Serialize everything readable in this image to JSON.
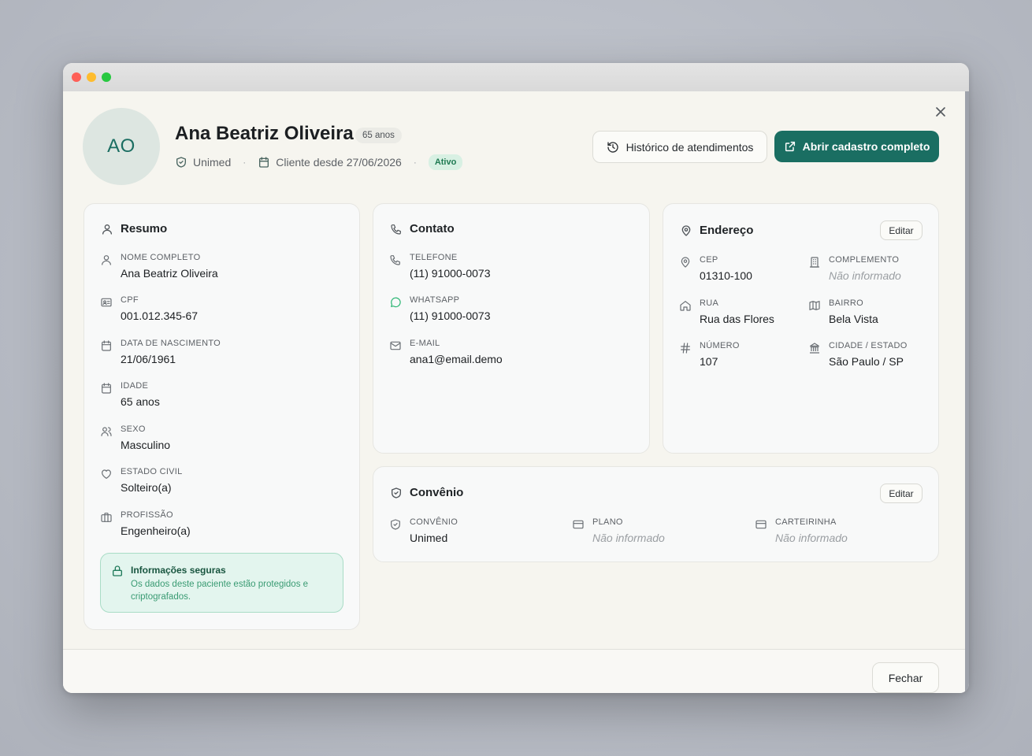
{
  "header": {
    "initials": "AO",
    "name": "Ana Beatriz Oliveira",
    "age_badge": "65 anos",
    "insurance": "Unimed",
    "client_since": "Cliente desde 27/06/2026",
    "status": "Ativo",
    "history_button": "Histórico de atendimentos",
    "open_button": "Abrir cadastro completo"
  },
  "resumo": {
    "title": "Resumo",
    "fields": [
      {
        "label": "NOME COMPLETO",
        "value": "Ana Beatriz Oliveira",
        "icon": "user-icon"
      },
      {
        "label": "CPF",
        "value": "001.012.345-67",
        "icon": "id-card-icon"
      },
      {
        "label": "DATA DE NASCIMENTO",
        "value": "21/06/1961",
        "icon": "calendar-icon"
      },
      {
        "label": "IDADE",
        "value": "65 anos",
        "icon": "calendar-icon"
      },
      {
        "label": "SEXO",
        "value": "Masculino",
        "icon": "users-icon"
      },
      {
        "label": "ESTADO CIVIL",
        "value": "Solteiro(a)",
        "icon": "heart-icon"
      },
      {
        "label": "PROFISSÃO",
        "value": "Engenheiro(a)",
        "icon": "briefcase-icon"
      }
    ],
    "secure_title": "Informações seguras",
    "secure_text": "Os dados deste paciente estão protegidos e criptografados."
  },
  "contato": {
    "title": "Contato",
    "fields": [
      {
        "label": "TELEFONE",
        "value": "(11) 91000-0073",
        "icon": "phone-icon"
      },
      {
        "label": "WHATSAPP",
        "value": "(11) 91000-0073",
        "icon": "whatsapp-icon"
      },
      {
        "label": "E-MAIL",
        "value": "ana1@email.demo",
        "icon": "mail-icon"
      }
    ]
  },
  "endereco": {
    "title": "Endereço",
    "edit": "Editar",
    "fields": [
      {
        "label": "CEP",
        "value": "01310-100",
        "icon": "map-pin-icon"
      },
      {
        "label": "COMPLEMENTO",
        "value": "Não informado",
        "icon": "building-icon"
      },
      {
        "label": "RUA",
        "value": "Rua das Flores",
        "icon": "home-icon"
      },
      {
        "label": "BAIRRO",
        "value": "Bela Vista",
        "icon": "map-icon"
      },
      {
        "label": "NÚMERO",
        "value": "107",
        "icon": "hash-icon"
      },
      {
        "label": "CIDADE / ESTADO",
        "value": "São Paulo / SP",
        "icon": "landmark-icon"
      }
    ]
  },
  "convenio": {
    "title": "Convênio",
    "edit": "Editar",
    "fields": [
      {
        "label": "CONVÊNIO",
        "value": "Unimed",
        "icon": "shield-icon"
      },
      {
        "label": "PLANO",
        "value": "Não informado",
        "icon": "card-icon"
      },
      {
        "label": "CARTEIRINHA",
        "value": "Não informado",
        "icon": "card-icon"
      }
    ]
  },
  "footer": {
    "close_button": "Fechar"
  },
  "colors": {
    "primary": "#1a6e62",
    "status_bg": "#d8f0e3",
    "status_text": "#1f7a52",
    "secure_bg": "#e3f5ee"
  }
}
